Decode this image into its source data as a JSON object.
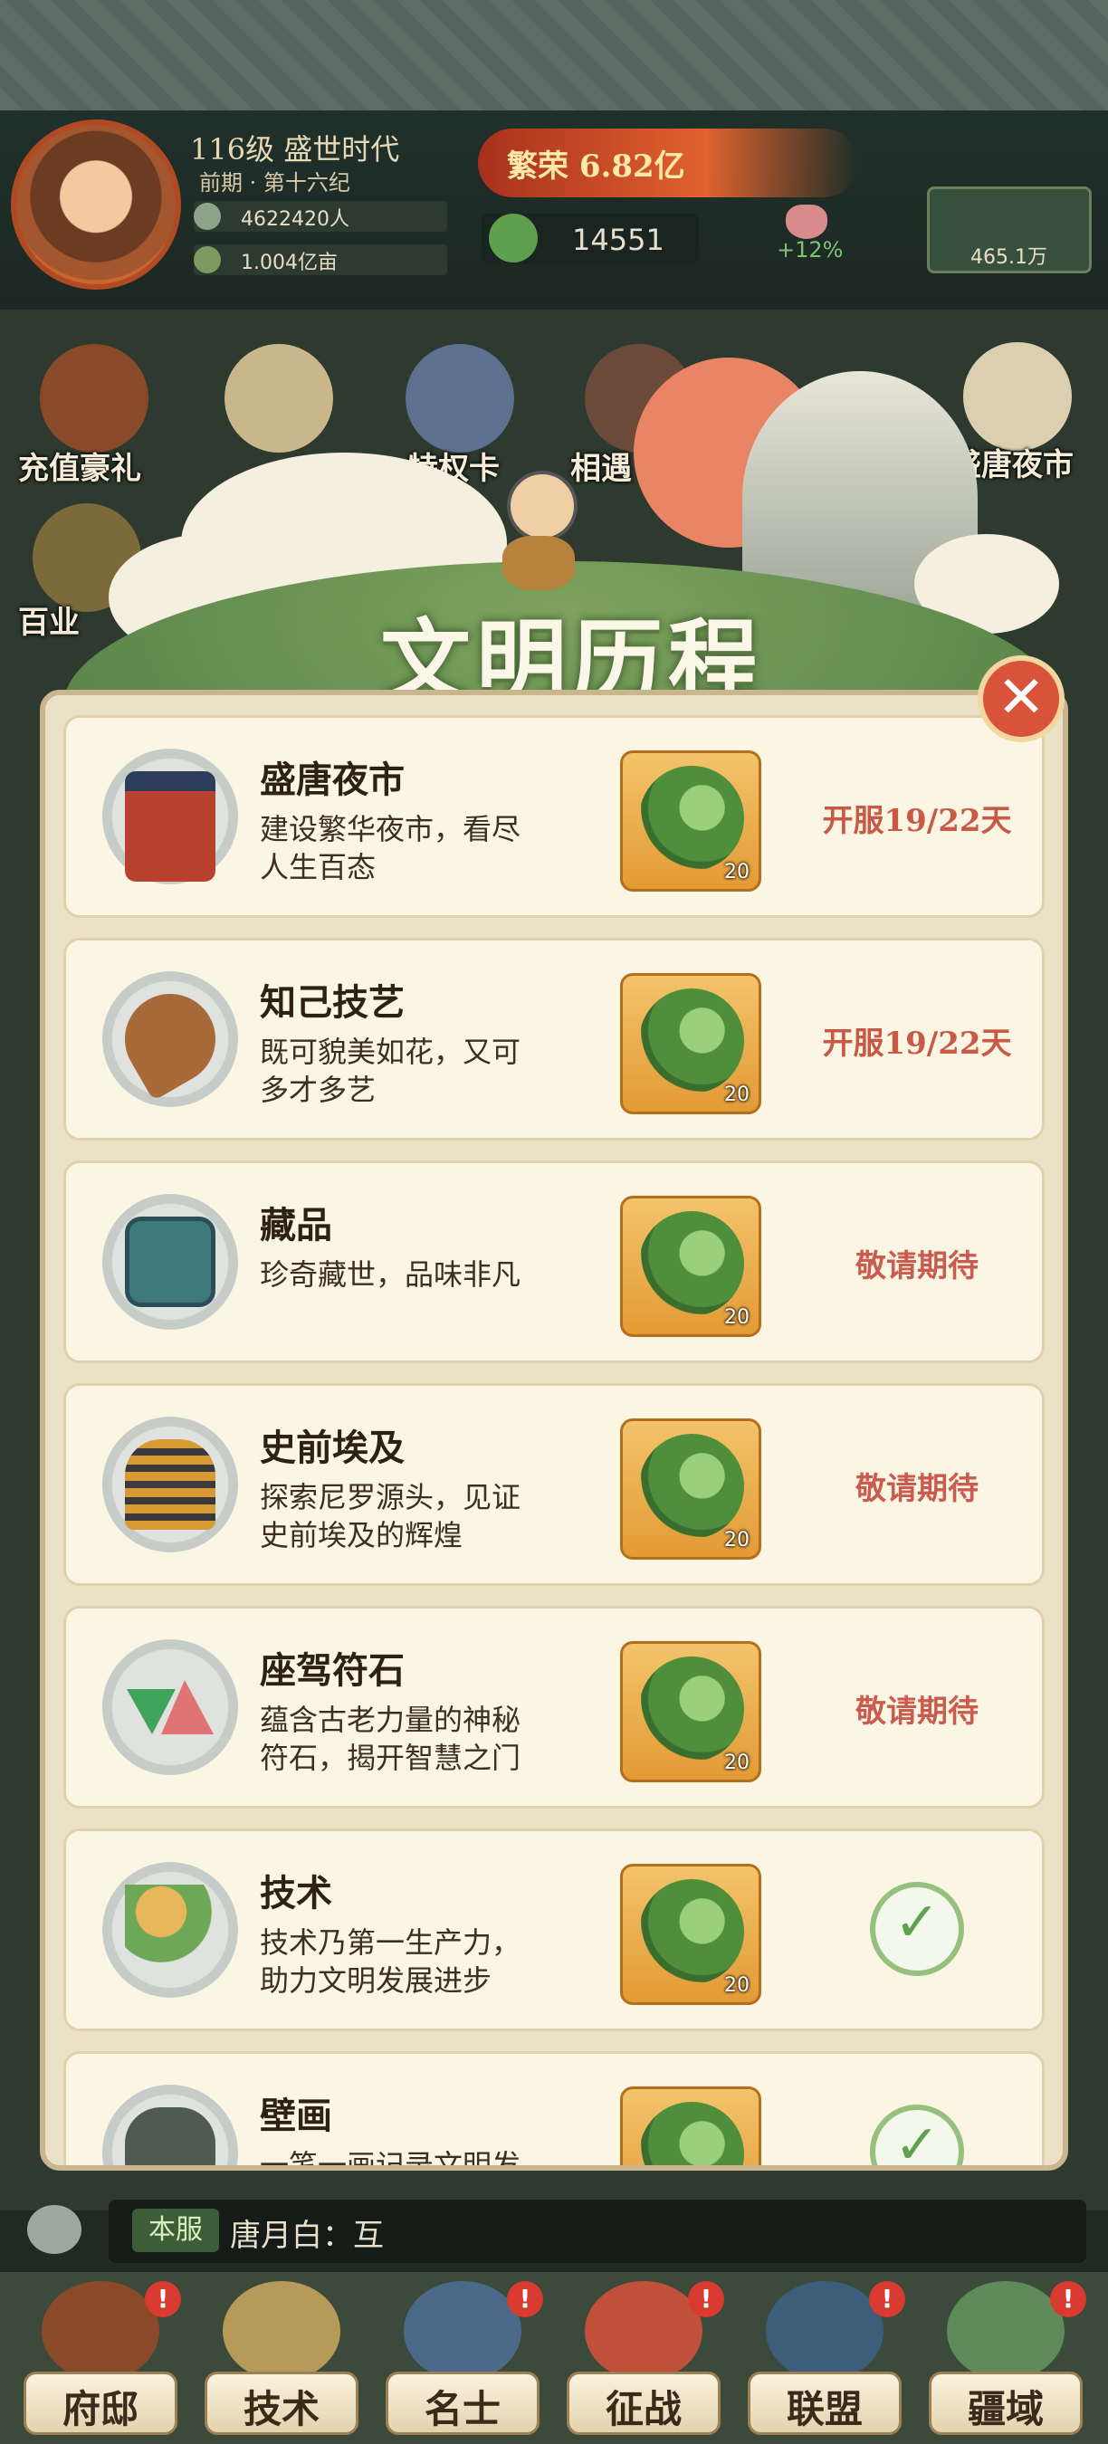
{
  "player": {
    "level_title": "116级 盛世时代",
    "era": "前期 · 第十六纪",
    "population": "4622420人",
    "land": "1.004亿亩"
  },
  "prosperity": "繁荣 6.82亿",
  "jade_count": "14551",
  "bonus": "+12%",
  "gold": "465.1万",
  "shortcuts": [
    {
      "label": "充值豪礼"
    },
    {
      "label": "特权卡"
    },
    {
      "label": "相遇"
    },
    {
      "label": "盛唐夜市"
    },
    {
      "label": "百业"
    }
  ],
  "panel": {
    "title": "文明历程",
    "rows": [
      {
        "name": "盛唐夜市",
        "desc1": "建设繁华夜市，看尽",
        "desc2": "人生百态",
        "reward_qty": "20",
        "status": "开服19/22天",
        "icon": "night-market-gate-icon"
      },
      {
        "name": "知己技艺",
        "desc1": "既可貌美如花，又可",
        "desc2": "多才多艺",
        "reward_qty": "20",
        "status": "开服19/22天",
        "icon": "pipa-icon"
      },
      {
        "name": "藏品",
        "desc1": "珍奇藏世，品味非凡",
        "desc2": "",
        "reward_qty": "20",
        "status": "敬请期待",
        "icon": "bronze-vessel-icon"
      },
      {
        "name": "史前埃及",
        "desc1": "探索尼罗源头，见证",
        "desc2": "史前埃及的辉煌",
        "reward_qty": "20",
        "status": "敬请期待",
        "icon": "pharaoh-icon"
      },
      {
        "name": "座驾符石",
        "desc1": "蕴含古老力量的神秘",
        "desc2": "符石，揭开智慧之门",
        "reward_qty": "20",
        "status": "敬请期待",
        "icon": "rune-stone-icon"
      },
      {
        "name": "技术",
        "desc1": "技术乃第一生产力，",
        "desc2": "助力文明发展进步",
        "reward_qty": "20",
        "status": "",
        "icon": "wheat-icon"
      },
      {
        "name": "壁画",
        "desc1": "一笔一画记录文明发",
        "desc2": "",
        "reward_qty": "",
        "status": "",
        "icon": "mural-stone-icon"
      }
    ]
  },
  "chat": {
    "channel": "本服",
    "message": "唐月白：互"
  },
  "nav": [
    {
      "label": "府邸",
      "badge": "!"
    },
    {
      "label": "技术",
      "badge": ""
    },
    {
      "label": "名士",
      "badge": "!"
    },
    {
      "label": "征战",
      "badge": "!"
    },
    {
      "label": "联盟",
      "badge": "!"
    },
    {
      "label": "疆域",
      "badge": "!"
    }
  ],
  "colors": {
    "accent_red": "#c85a45",
    "jade_green": "#4f8f3c",
    "panel_bg": "#ebe1c6"
  }
}
